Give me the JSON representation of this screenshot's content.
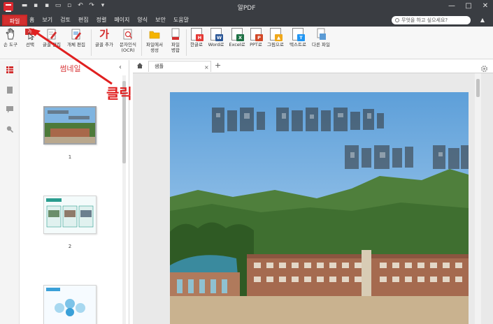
{
  "window": {
    "title": "알PDF",
    "controls": [
      "—",
      "□",
      "✕"
    ]
  },
  "quick_access": [
    "folder-icon",
    "save-icon",
    "save-as-icon",
    "print-icon",
    "export-icon",
    "undo-icon",
    "redo-icon",
    "customize-icon"
  ],
  "menu": {
    "file_label": "파일",
    "items": [
      "홈",
      "보기",
      "검토",
      "편집",
      "정렬",
      "페이지",
      "양식",
      "보안",
      "도움말"
    ],
    "search_placeholder": "무엇을 하고 싶으세요?"
  },
  "ribbon": {
    "tools": [
      {
        "label": "손 도구",
        "icon": "hand-icon"
      },
      {
        "label": "선택",
        "icon": "select-text-icon",
        "badge_text": "가"
      },
      {
        "label": "글꼴 편집",
        "icon": "text-edit-icon"
      },
      {
        "label": "개체 편집",
        "icon": "object-edit-icon"
      },
      {
        "label": "글꼴 추가",
        "icon": "add-text-icon",
        "glyph": "가"
      },
      {
        "label": "문자인식\n(OCR)",
        "icon": "ocr-icon"
      },
      {
        "label": "파일에서\n생성",
        "icon": "create-from-file-icon"
      },
      {
        "label": "파일\n병합",
        "icon": "merge-files-icon"
      },
      {
        "label": "한글로",
        "icon": "to-hwp-icon",
        "badge_text": "H",
        "badge_color": "#e53935"
      },
      {
        "label": "Word로",
        "icon": "to-word-icon",
        "badge_text": "W",
        "badge_color": "#2b5797"
      },
      {
        "label": "Excel로",
        "icon": "to-excel-icon",
        "badge_text": "X",
        "badge_color": "#1e7145"
      },
      {
        "label": "PPT로",
        "icon": "to-ppt-icon",
        "badge_text": "P",
        "badge_color": "#d24726"
      },
      {
        "label": "그림으로",
        "icon": "to-image-icon",
        "badge_text": "▲",
        "badge_color": "#f0a81a"
      },
      {
        "label": "텍스트로",
        "icon": "to-text-icon",
        "badge_text": "T",
        "badge_color": "#2196f3"
      },
      {
        "label": "다른 파일",
        "icon": "to-other-icon"
      }
    ]
  },
  "sidebar_icons": [
    "thumbnail-view-icon",
    "bookmark-icon",
    "comment-icon",
    "search-panel-icon"
  ],
  "thumbnail_panel": {
    "title": "썸네일",
    "pages": [
      {
        "number": "1",
        "selected": true
      },
      {
        "number": "2",
        "selected": false
      },
      {
        "number": "",
        "selected": false
      }
    ]
  },
  "tabs": [
    {
      "label": "샘플",
      "close": "×"
    }
  ],
  "tab_add": "+",
  "annotation": {
    "text": "클릭",
    "color": "#e02020"
  },
  "colors": {
    "titlebar": "#3a3d42",
    "file_menu": "#d32f2f",
    "accent": "#e02020"
  }
}
